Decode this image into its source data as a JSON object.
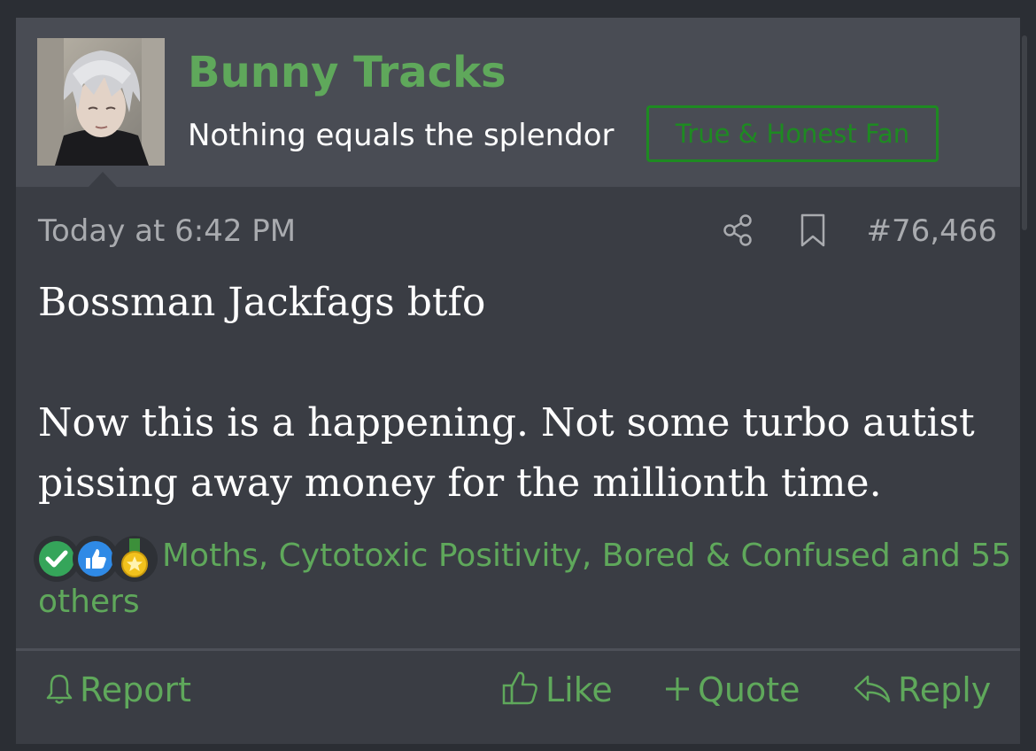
{
  "author": {
    "name": "Bunny Tracks",
    "title": "Nothing equals the splendor",
    "banner": "True & Honest Fan"
  },
  "meta": {
    "date": "Today at 6:42 PM",
    "post_number": "#76,466",
    "icons": [
      "share-icon",
      "bookmark-icon"
    ]
  },
  "body": {
    "line1": "Bossman Jackfags btfo",
    "line2": "Now this is a happening. Not some turbo autist",
    "line3": "pissing away money for the millionth time."
  },
  "reactions": {
    "icons": [
      "agree-icon",
      "like-icon",
      "winner-icon"
    ],
    "text": "Moths, Cytotoxic Positivity, Bored & Confused and 55 others"
  },
  "actions": {
    "report": "Report",
    "like": "Like",
    "quote": "Quote",
    "reply": "Reply"
  },
  "colors": {
    "accent_green": "#5fa85b",
    "banner_green": "#1e8a22",
    "post_bg": "#3a3d44",
    "header_bg": "#494c54"
  }
}
